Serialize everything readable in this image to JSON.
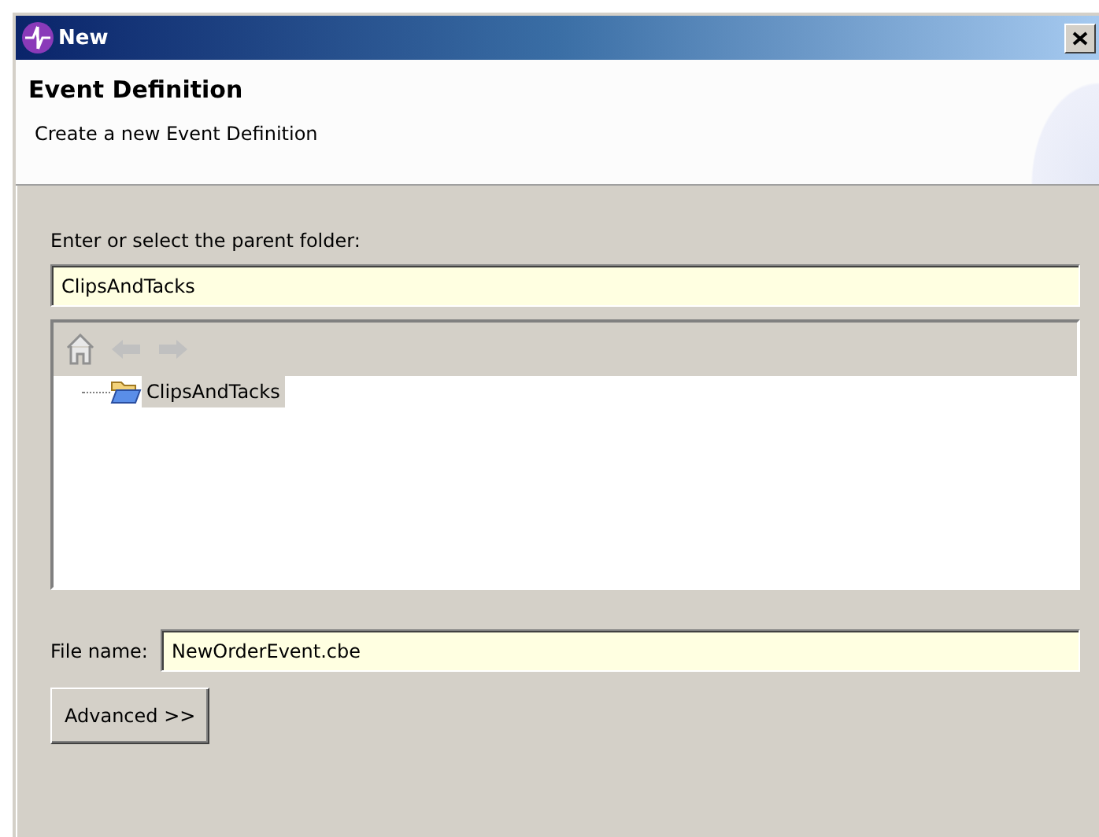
{
  "window": {
    "title": "New"
  },
  "header": {
    "title": "Event Definition",
    "description": "Create a new Event Definition"
  },
  "parent_folder": {
    "label": "Enter or select the parent folder:",
    "value": "ClipsAndTacks"
  },
  "tree": {
    "nav": [
      {
        "kind": "home",
        "disabled": true
      },
      {
        "kind": "back",
        "disabled": true
      },
      {
        "kind": "forward",
        "disabled": true
      }
    ],
    "items": [
      {
        "label": "ClipsAndTacks",
        "selected": true
      }
    ]
  },
  "file_name": {
    "label": "File name:",
    "value": "NewOrderEvent.cbe"
  },
  "buttons": [
    "Advanced >>"
  ]
}
